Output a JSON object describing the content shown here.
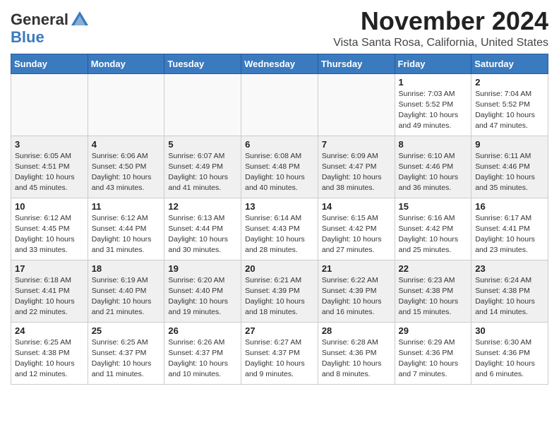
{
  "header": {
    "logo_general": "General",
    "logo_blue": "Blue",
    "month_title": "November 2024",
    "location": "Vista Santa Rosa, California, United States"
  },
  "days_of_week": [
    "Sunday",
    "Monday",
    "Tuesday",
    "Wednesday",
    "Thursday",
    "Friday",
    "Saturday"
  ],
  "weeks": [
    [
      {
        "day": "",
        "info": ""
      },
      {
        "day": "",
        "info": ""
      },
      {
        "day": "",
        "info": ""
      },
      {
        "day": "",
        "info": ""
      },
      {
        "day": "",
        "info": ""
      },
      {
        "day": "1",
        "info": "Sunrise: 7:03 AM\nSunset: 5:52 PM\nDaylight: 10 hours and 49 minutes."
      },
      {
        "day": "2",
        "info": "Sunrise: 7:04 AM\nSunset: 5:52 PM\nDaylight: 10 hours and 47 minutes."
      }
    ],
    [
      {
        "day": "3",
        "info": "Sunrise: 6:05 AM\nSunset: 4:51 PM\nDaylight: 10 hours and 45 minutes."
      },
      {
        "day": "4",
        "info": "Sunrise: 6:06 AM\nSunset: 4:50 PM\nDaylight: 10 hours and 43 minutes."
      },
      {
        "day": "5",
        "info": "Sunrise: 6:07 AM\nSunset: 4:49 PM\nDaylight: 10 hours and 41 minutes."
      },
      {
        "day": "6",
        "info": "Sunrise: 6:08 AM\nSunset: 4:48 PM\nDaylight: 10 hours and 40 minutes."
      },
      {
        "day": "7",
        "info": "Sunrise: 6:09 AM\nSunset: 4:47 PM\nDaylight: 10 hours and 38 minutes."
      },
      {
        "day": "8",
        "info": "Sunrise: 6:10 AM\nSunset: 4:46 PM\nDaylight: 10 hours and 36 minutes."
      },
      {
        "day": "9",
        "info": "Sunrise: 6:11 AM\nSunset: 4:46 PM\nDaylight: 10 hours and 35 minutes."
      }
    ],
    [
      {
        "day": "10",
        "info": "Sunrise: 6:12 AM\nSunset: 4:45 PM\nDaylight: 10 hours and 33 minutes."
      },
      {
        "day": "11",
        "info": "Sunrise: 6:12 AM\nSunset: 4:44 PM\nDaylight: 10 hours and 31 minutes."
      },
      {
        "day": "12",
        "info": "Sunrise: 6:13 AM\nSunset: 4:44 PM\nDaylight: 10 hours and 30 minutes."
      },
      {
        "day": "13",
        "info": "Sunrise: 6:14 AM\nSunset: 4:43 PM\nDaylight: 10 hours and 28 minutes."
      },
      {
        "day": "14",
        "info": "Sunrise: 6:15 AM\nSunset: 4:42 PM\nDaylight: 10 hours and 27 minutes."
      },
      {
        "day": "15",
        "info": "Sunrise: 6:16 AM\nSunset: 4:42 PM\nDaylight: 10 hours and 25 minutes."
      },
      {
        "day": "16",
        "info": "Sunrise: 6:17 AM\nSunset: 4:41 PM\nDaylight: 10 hours and 23 minutes."
      }
    ],
    [
      {
        "day": "17",
        "info": "Sunrise: 6:18 AM\nSunset: 4:41 PM\nDaylight: 10 hours and 22 minutes."
      },
      {
        "day": "18",
        "info": "Sunrise: 6:19 AM\nSunset: 4:40 PM\nDaylight: 10 hours and 21 minutes."
      },
      {
        "day": "19",
        "info": "Sunrise: 6:20 AM\nSunset: 4:40 PM\nDaylight: 10 hours and 19 minutes."
      },
      {
        "day": "20",
        "info": "Sunrise: 6:21 AM\nSunset: 4:39 PM\nDaylight: 10 hours and 18 minutes."
      },
      {
        "day": "21",
        "info": "Sunrise: 6:22 AM\nSunset: 4:39 PM\nDaylight: 10 hours and 16 minutes."
      },
      {
        "day": "22",
        "info": "Sunrise: 6:23 AM\nSunset: 4:38 PM\nDaylight: 10 hours and 15 minutes."
      },
      {
        "day": "23",
        "info": "Sunrise: 6:24 AM\nSunset: 4:38 PM\nDaylight: 10 hours and 14 minutes."
      }
    ],
    [
      {
        "day": "24",
        "info": "Sunrise: 6:25 AM\nSunset: 4:38 PM\nDaylight: 10 hours and 12 minutes."
      },
      {
        "day": "25",
        "info": "Sunrise: 6:25 AM\nSunset: 4:37 PM\nDaylight: 10 hours and 11 minutes."
      },
      {
        "day": "26",
        "info": "Sunrise: 6:26 AM\nSunset: 4:37 PM\nDaylight: 10 hours and 10 minutes."
      },
      {
        "day": "27",
        "info": "Sunrise: 6:27 AM\nSunset: 4:37 PM\nDaylight: 10 hours and 9 minutes."
      },
      {
        "day": "28",
        "info": "Sunrise: 6:28 AM\nSunset: 4:36 PM\nDaylight: 10 hours and 8 minutes."
      },
      {
        "day": "29",
        "info": "Sunrise: 6:29 AM\nSunset: 4:36 PM\nDaylight: 10 hours and 7 minutes."
      },
      {
        "day": "30",
        "info": "Sunrise: 6:30 AM\nSunset: 4:36 PM\nDaylight: 10 hours and 6 minutes."
      }
    ]
  ]
}
